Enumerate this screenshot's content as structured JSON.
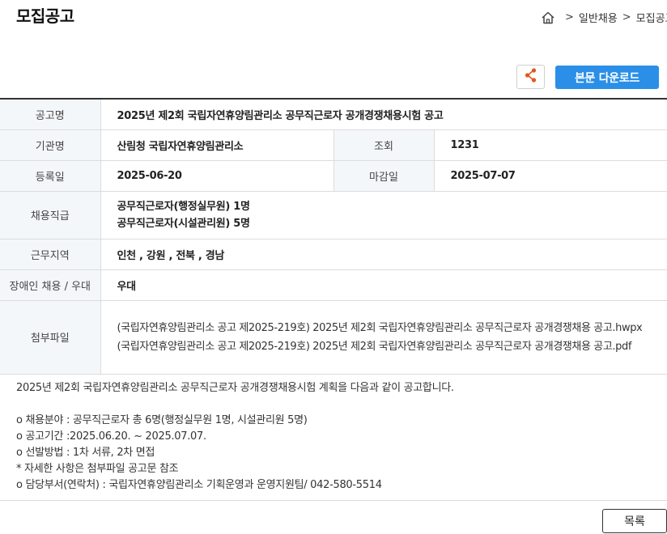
{
  "header": {
    "title": "모집공고",
    "breadcrumb": {
      "sep1": ">",
      "item1": "일반채용",
      "sep2": ">",
      "item2": "모집공고"
    }
  },
  "actions": {
    "download_label": "본문 다운로드"
  },
  "info": {
    "title_label": "공고명",
    "title_value": "2025년 제2회 국립자연휴양림관리소 공무직근로자 공개경쟁채용시험 공고",
    "org_label": "기관명",
    "org_value": "산림청 국립자연휴양림관리소",
    "views_label": "조회",
    "views_value": "1231",
    "reg_label": "등록일",
    "reg_value": "2025-06-20",
    "deadline_label": "마감일",
    "deadline_value": "2025-07-07",
    "position_label": "채용직급",
    "positions": [
      "공무직근로자(행정실무원) 1명",
      "공무직근로자(시설관리원) 5명"
    ],
    "region_label": "근무지역",
    "region_value": "인천 , 강원 , 전북 , 경남",
    "disabled_label": "장애인 채용 / 우대",
    "disabled_value": "우대",
    "attach_label": "첨부파일",
    "attachments": [
      "(국립자연휴양림관리소 공고 제2025-219호) 2025년 제2회 국립자연휴양림관리소 공무직근로자 공개경쟁채용 공고.hwpx",
      "(국립자연휴양림관리소 공고 제2025-219호) 2025년 제2회 국립자연휴양림관리소 공무직근로자 공개경쟁채용 공고.pdf"
    ]
  },
  "body": {
    "intro": "2025년 제2회 국립자연휴양림관리소 공무직근로자 공개경쟁채용시험 계획을 다음과 같이 공고합니다.",
    "lines": [
      "o 채용분야 : 공무직근로자 총 6명(행정실무원 1명,  시설관리원 5명)",
      "o 공고기간 :2025.06.20. ~ 2025.07.07.",
      "o 선발방법 : 1차 서류, 2차 면접",
      "* 자세한 사항은 첨부파일 공고문 참조",
      "o 담당부서(연락처) : 국립자연휴양림관리소 기획운영과 운영지원팀/ 042-580-5514"
    ]
  },
  "footer": {
    "list_label": "목록"
  }
}
